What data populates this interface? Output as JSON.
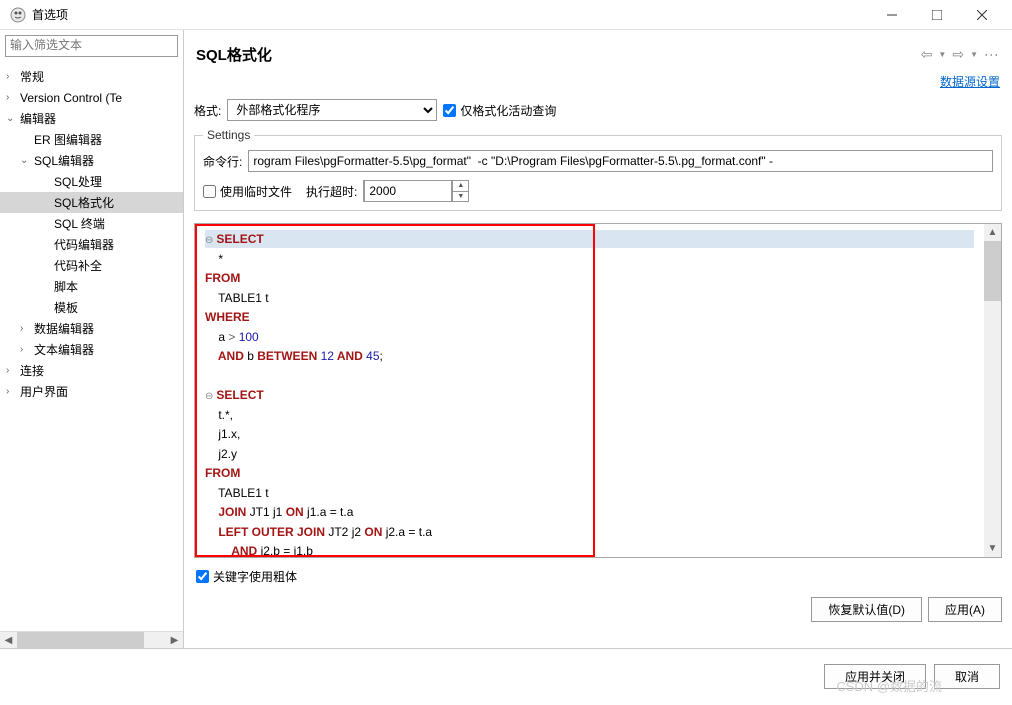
{
  "window": {
    "title": "首选项"
  },
  "sidebar": {
    "filter_placeholder": "输入筛选文本",
    "items": [
      {
        "label": "常规",
        "expandable": true,
        "expanded": false,
        "level": 0
      },
      {
        "label": "Version Control (Te",
        "expandable": true,
        "expanded": false,
        "level": 0
      },
      {
        "label": "编辑器",
        "expandable": true,
        "expanded": true,
        "level": 0
      },
      {
        "label": "ER 图编辑器",
        "expandable": false,
        "expanded": false,
        "level": 1
      },
      {
        "label": "SQL编辑器",
        "expandable": true,
        "expanded": true,
        "level": 1
      },
      {
        "label": "SQL处理",
        "expandable": false,
        "expanded": false,
        "level": 2
      },
      {
        "label": "SQL格式化",
        "expandable": false,
        "expanded": false,
        "level": 2,
        "selected": true
      },
      {
        "label": "SQL 终端",
        "expandable": false,
        "expanded": false,
        "level": 2
      },
      {
        "label": "代码编辑器",
        "expandable": false,
        "expanded": false,
        "level": 2
      },
      {
        "label": "代码补全",
        "expandable": false,
        "expanded": false,
        "level": 2
      },
      {
        "label": "脚本",
        "expandable": false,
        "expanded": false,
        "level": 2
      },
      {
        "label": "模板",
        "expandable": false,
        "expanded": false,
        "level": 2
      },
      {
        "label": "数据编辑器",
        "expandable": true,
        "expanded": false,
        "level": 1
      },
      {
        "label": "文本编辑器",
        "expandable": true,
        "expanded": false,
        "level": 1
      },
      {
        "label": "连接",
        "expandable": true,
        "expanded": false,
        "level": 0
      },
      {
        "label": "用户界面",
        "expandable": true,
        "expanded": false,
        "level": 0
      }
    ]
  },
  "content": {
    "title": "SQL格式化",
    "datasource_link": "数据源设置",
    "format_label": "格式:",
    "format_value": "外部格式化程序",
    "format_only_active_label": "仅格式化活动查询",
    "format_only_active_checked": true,
    "settings_legend": "Settings",
    "cmdline_label": "命令行:",
    "cmdline_value": "rogram Files\\pgFormatter-5.5\\pg_format\"  -c \"D:\\Program Files\\pgFormatter-5.5\\.pg_format.conf\" -",
    "use_temp_label": "使用临时文件",
    "use_temp_checked": false,
    "timeout_label": "执行超时:",
    "timeout_value": "2000",
    "keywords_bold_label": "关键字使用粗体",
    "keywords_bold_checked": true,
    "restore_defaults": "恢复默认值(D)",
    "apply": "应用(A)"
  },
  "footer": {
    "apply_close": "应用并关闭",
    "cancel": "取消"
  },
  "watermark": "CSDN @数据的流",
  "code": {
    "line1_kw": "SELECT",
    "line2": "    *",
    "line3_kw": "FROM",
    "line4": "    TABLE1 t",
    "line5_kw": "WHERE",
    "line6_a": "    a ",
    "line6_op": "> ",
    "line6_num": "100",
    "line7_and": "    AND",
    "line7_b": " b ",
    "line7_between": "BETWEEN ",
    "line7_n1": "12",
    "line7_and2": " AND ",
    "line7_n2": "45",
    "line7_semi": ";",
    "line9_kw": "SELECT",
    "line10": "    t.*,",
    "line11": "    j1.x,",
    "line12": "    j2.y",
    "line13_kw": "FROM",
    "line14": "    TABLE1 t",
    "line15_join": "    JOIN",
    "line15_rest": " JT1 j1 ",
    "line15_on": "ON",
    "line15_cond": " j1.a = t.a",
    "line16_loj": "    LEFT OUTER JOIN",
    "line16_rest": " JT2 j2 ",
    "line16_on": "ON",
    "line16_cond": " j2.a = t.a",
    "line17_and": "        AND",
    "line17_cond": " j2.b = j1.b"
  }
}
